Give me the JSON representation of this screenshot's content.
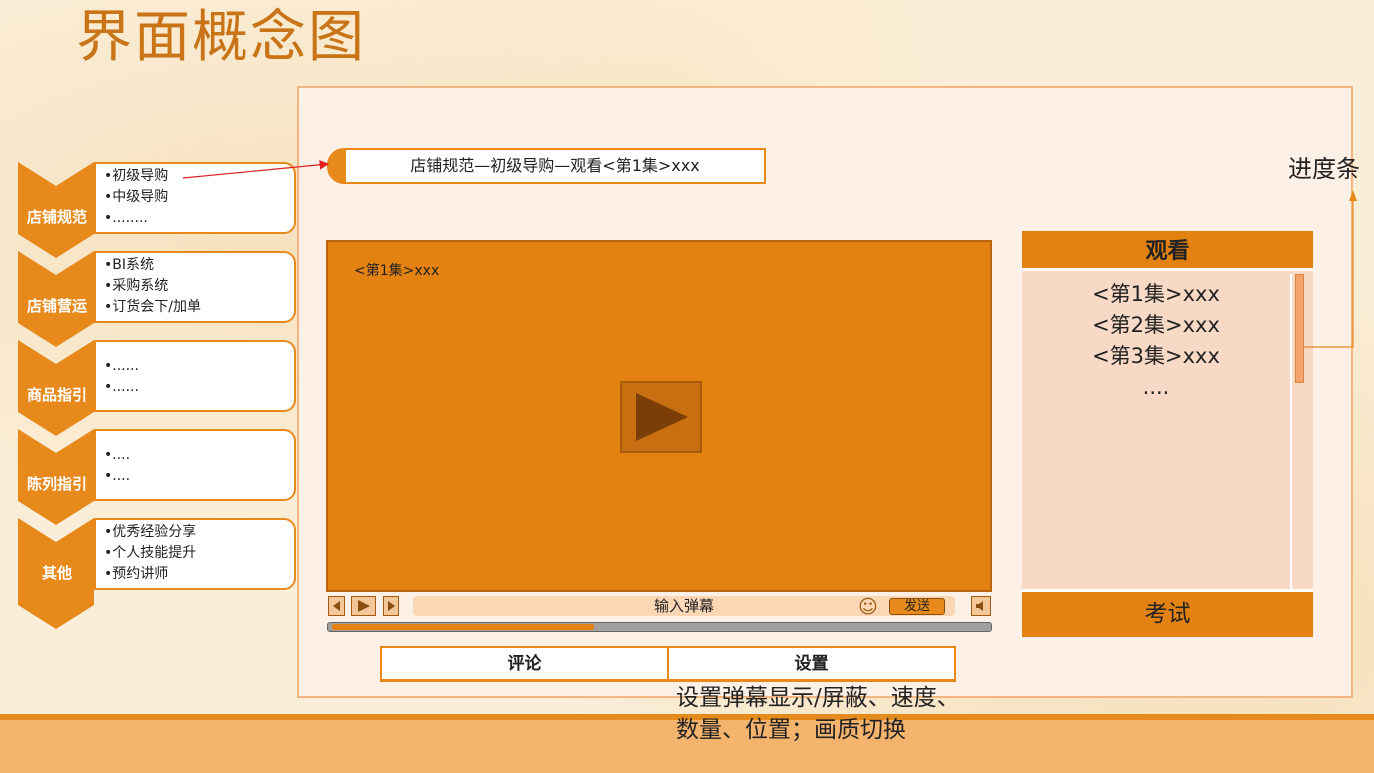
{
  "page": {
    "title": "界面概念图"
  },
  "nav": {
    "categories": [
      {
        "label": "店铺规范",
        "items": [
          "•初级导购",
          "•中级导购",
          "•........"
        ]
      },
      {
        "label": "店铺营运",
        "items": [
          "•BI系统",
          "•采购系统",
          "•订货会下/加单"
        ]
      },
      {
        "label": "商品指引",
        "items": [
          "•......",
          "•......"
        ]
      },
      {
        "label": "陈列指引",
        "items": [
          "•....",
          "•...."
        ]
      },
      {
        "label": "其他",
        "items": [
          "•优秀经验分享",
          "•个人技能提升",
          "•预约讲师"
        ]
      }
    ]
  },
  "breadcrumb": {
    "text": "店铺规范—初级导购—观看<第1集>xxx"
  },
  "player": {
    "video_title": "<第1集>xxx",
    "danmaku_placeholder": "输入弹幕",
    "send_label": "发送",
    "progress": 0.4
  },
  "tabs": {
    "comment_label": "评论",
    "settings_label": "设置",
    "settings_note_line1": "设置弹幕显示/屏蔽、速度、",
    "settings_note_line2": "数量、位置；画质切换"
  },
  "side_panel": {
    "header": "观看",
    "episodes": [
      "<第1集>xxx",
      "<第2集>xxx",
      "<第3集>xxx",
      "...."
    ],
    "footer": "考试"
  },
  "annotation": {
    "progress_label": "进度条"
  },
  "colors": {
    "accent": "#e8891c",
    "video_bg": "#e48211",
    "title": "#c87417",
    "panel_bg": "#f7d9c6"
  }
}
